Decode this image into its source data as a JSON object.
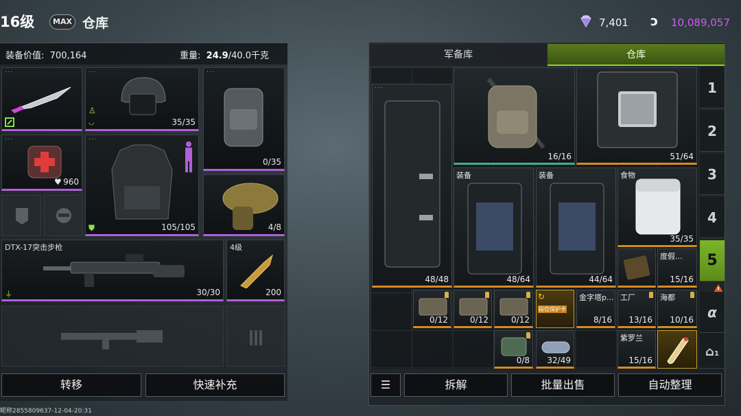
{
  "header": {
    "level": "16级",
    "max_badge": "MAX",
    "title": "仓库",
    "diamonds": "7,401",
    "coins": "10,089,057",
    "colors": {
      "coins": "#cf5cf0",
      "accent_green": "#7bb52a",
      "rarity_purple": "#b060d8",
      "rarity_gold": "#d68a22"
    }
  },
  "equipment": {
    "value_label": "装备价值:",
    "value": "700,164",
    "weight_label": "重量:",
    "weight_current": "24.9",
    "weight_max": "/40.0千克",
    "helmet_count": "35/35",
    "backpack_count": "0/35",
    "medkit_count": "960",
    "armor_count": "105/105",
    "grenade_count": "4/8",
    "weapon_name": "DTX-17突击步枪",
    "weapon_ammo": "30/30",
    "ammo_tier": "4级",
    "ammo_count": "200"
  },
  "left_actions": {
    "transfer": "转移",
    "quick_refill": "快速补充"
  },
  "footer_text": "昵称2855809637-12-04-20:31",
  "storage": {
    "tabs": [
      "军备库",
      "仓库"
    ],
    "pages": [
      "1",
      "2",
      "3",
      "4",
      "5"
    ],
    "alpha": "α",
    "house_page": "1",
    "items": {
      "bag_counter": "16/16",
      "case_counter": "51/64",
      "tall_case_counter": "48/48",
      "gear_case1_tag": "装备",
      "gear_case1_counter": "48/64",
      "gear_case2_tag": "装备",
      "gear_case2_counter": "44/64",
      "food_tag": "食物",
      "food_counter": "35/35",
      "vacation_tag": "度假...",
      "vacation_counter": "15/16",
      "box1_counter": "0/12",
      "box2_counter": "0/12",
      "box3_counter": "0/12",
      "protect_card": "段位保护卡",
      "key1_tag": "金字塔p...",
      "key1_counter": "8/16",
      "key2_tag": "工厂",
      "key2_counter": "13/16",
      "key3_tag": "海都",
      "key3_counter": "10/16",
      "key4_tag": "紫罗兰",
      "key4_counter": "15/16",
      "pouch_counter": "0/8",
      "capsule_counter": "32/49"
    }
  },
  "right_actions": {
    "dismantle": "拆解",
    "bulk_sell": "批量出售",
    "auto_sort": "自动整理"
  }
}
